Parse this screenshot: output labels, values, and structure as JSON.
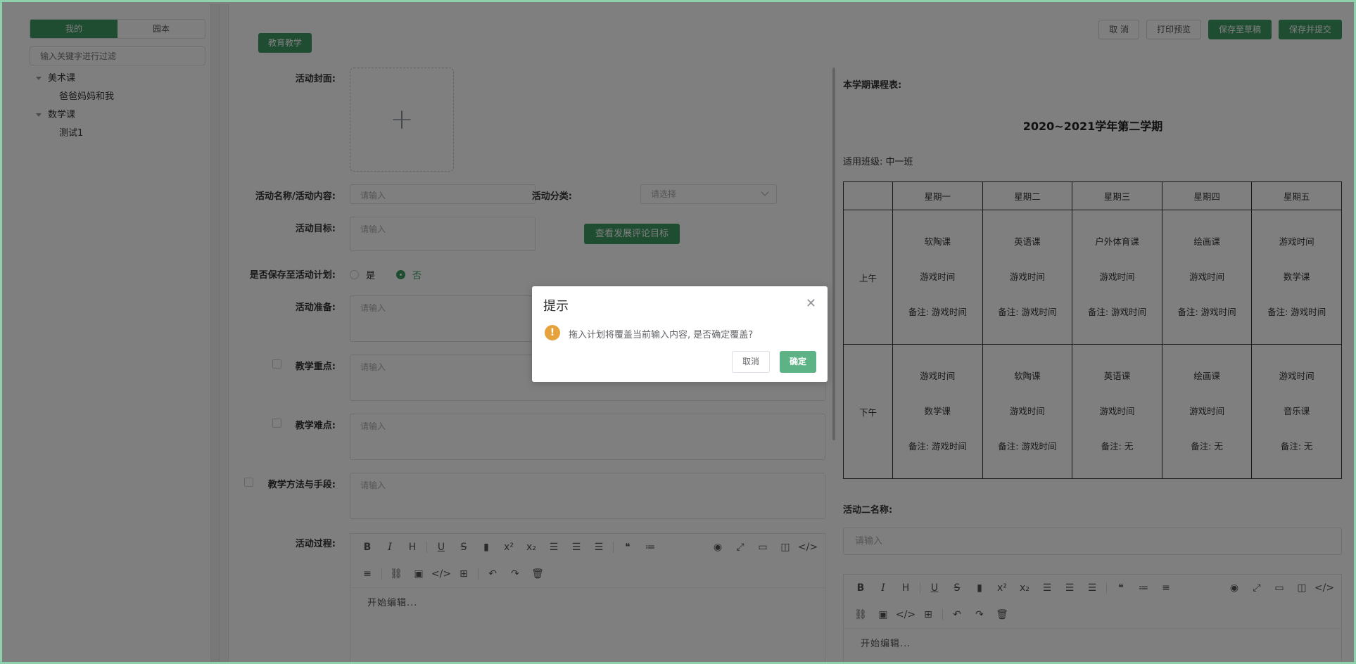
{
  "sidebar": {
    "tabs": [
      {
        "label": "我的",
        "active": true
      },
      {
        "label": "园本",
        "active": false
      }
    ],
    "filter_placeholder": "输入关键字进行过滤",
    "tree": [
      {
        "label": "美术课",
        "children": [
          "爸爸妈妈和我"
        ]
      },
      {
        "label": "数学课",
        "children": [
          "测试1"
        ]
      }
    ]
  },
  "toolbar": {
    "cancel": "取 消",
    "print_preview": "打印预览",
    "save_draft": "保存至草稿",
    "save_submit": "保存并提交"
  },
  "form": {
    "category_tag": "教育教学",
    "cover_label": "活动封面:",
    "name_label": "活动名称/活动内容:",
    "name_placeholder": "请输入",
    "category_label": "活动分类:",
    "category_placeholder": "请选择",
    "goal_label": "活动目标:",
    "goal_placeholder": "请输入",
    "view_goals_button": "查看发展评论目标",
    "save_plan_label": "是否保存至活动计划:",
    "radio_yes": "是",
    "radio_no": "否",
    "prep_label": "活动准备:",
    "prep_placeholder": "请输入",
    "keypoint_label": "教学重点:",
    "keypoint_placeholder": "请输入",
    "difficulty_label": "教学难点:",
    "difficulty_placeholder": "请输入",
    "method_label": "教学方法与手段:",
    "method_placeholder": "请输入",
    "process_label": "活动过程:",
    "editor_placeholder": "开始编辑..."
  },
  "schedule": {
    "title": "本学期课程表:",
    "semester": "2020~2021学年第二学期",
    "class_label": "适用班级: 中一班",
    "days": [
      "星期一",
      "星期二",
      "星期三",
      "星期四",
      "星期五"
    ],
    "rows": [
      {
        "period": "上午",
        "cells": [
          [
            "软陶课",
            "游戏时间",
            "备注: 游戏时间"
          ],
          [
            "英语课",
            "游戏时间",
            "备注: 游戏时间"
          ],
          [
            "户外体育课",
            "游戏时间",
            "备注: 游戏时间"
          ],
          [
            "绘画课",
            "游戏时间",
            "备注: 游戏时间"
          ],
          [
            "游戏时间",
            "数学课",
            "备注: 游戏时间"
          ]
        ]
      },
      {
        "period": "下午",
        "cells": [
          [
            "游戏时间",
            "数学课",
            "备注: 游戏时间"
          ],
          [
            "软陶课",
            "游戏时间",
            "备注: 游戏时间"
          ],
          [
            "英语课",
            "游戏时间",
            "备注: 无"
          ],
          [
            "绘画课",
            "游戏时间",
            "备注: 无"
          ],
          [
            "游戏时间",
            "音乐课",
            "备注: 无"
          ]
        ]
      }
    ],
    "activity2_label": "活动二名称:",
    "activity2_placeholder": "请输入",
    "editor2_placeholder": "开始编辑..."
  },
  "dialog": {
    "title": "提示",
    "message": "拖入计划将覆盖当前输入内容, 是否确定覆盖?",
    "cancel": "取消",
    "confirm": "确定",
    "warning_color": "#e6a23c"
  },
  "colors": {
    "accent": "#3f9a65"
  }
}
